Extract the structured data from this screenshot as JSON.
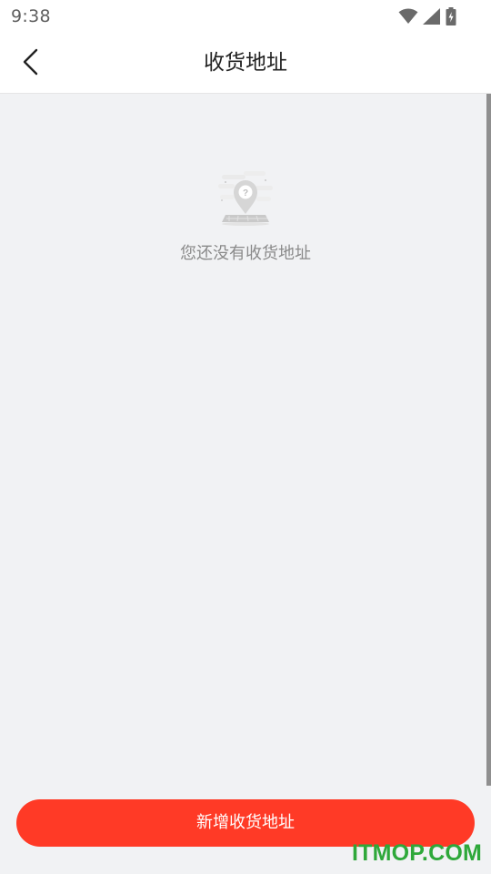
{
  "status_bar": {
    "time": "9:38",
    "icons": [
      "wifi-icon",
      "cellular-signal-icon",
      "battery-charging-icon"
    ]
  },
  "header": {
    "title": "收货地址",
    "back_icon": "chevron-left-icon"
  },
  "empty_state": {
    "icon": "location-map-icon",
    "message": "您还没有收货地址"
  },
  "footer": {
    "add_button_label": "新增收货地址"
  },
  "watermark": "ITMOP.COM",
  "colors": {
    "accent": "#ff3a26",
    "background": "#f1f2f4",
    "watermark": "#2ea83a"
  }
}
